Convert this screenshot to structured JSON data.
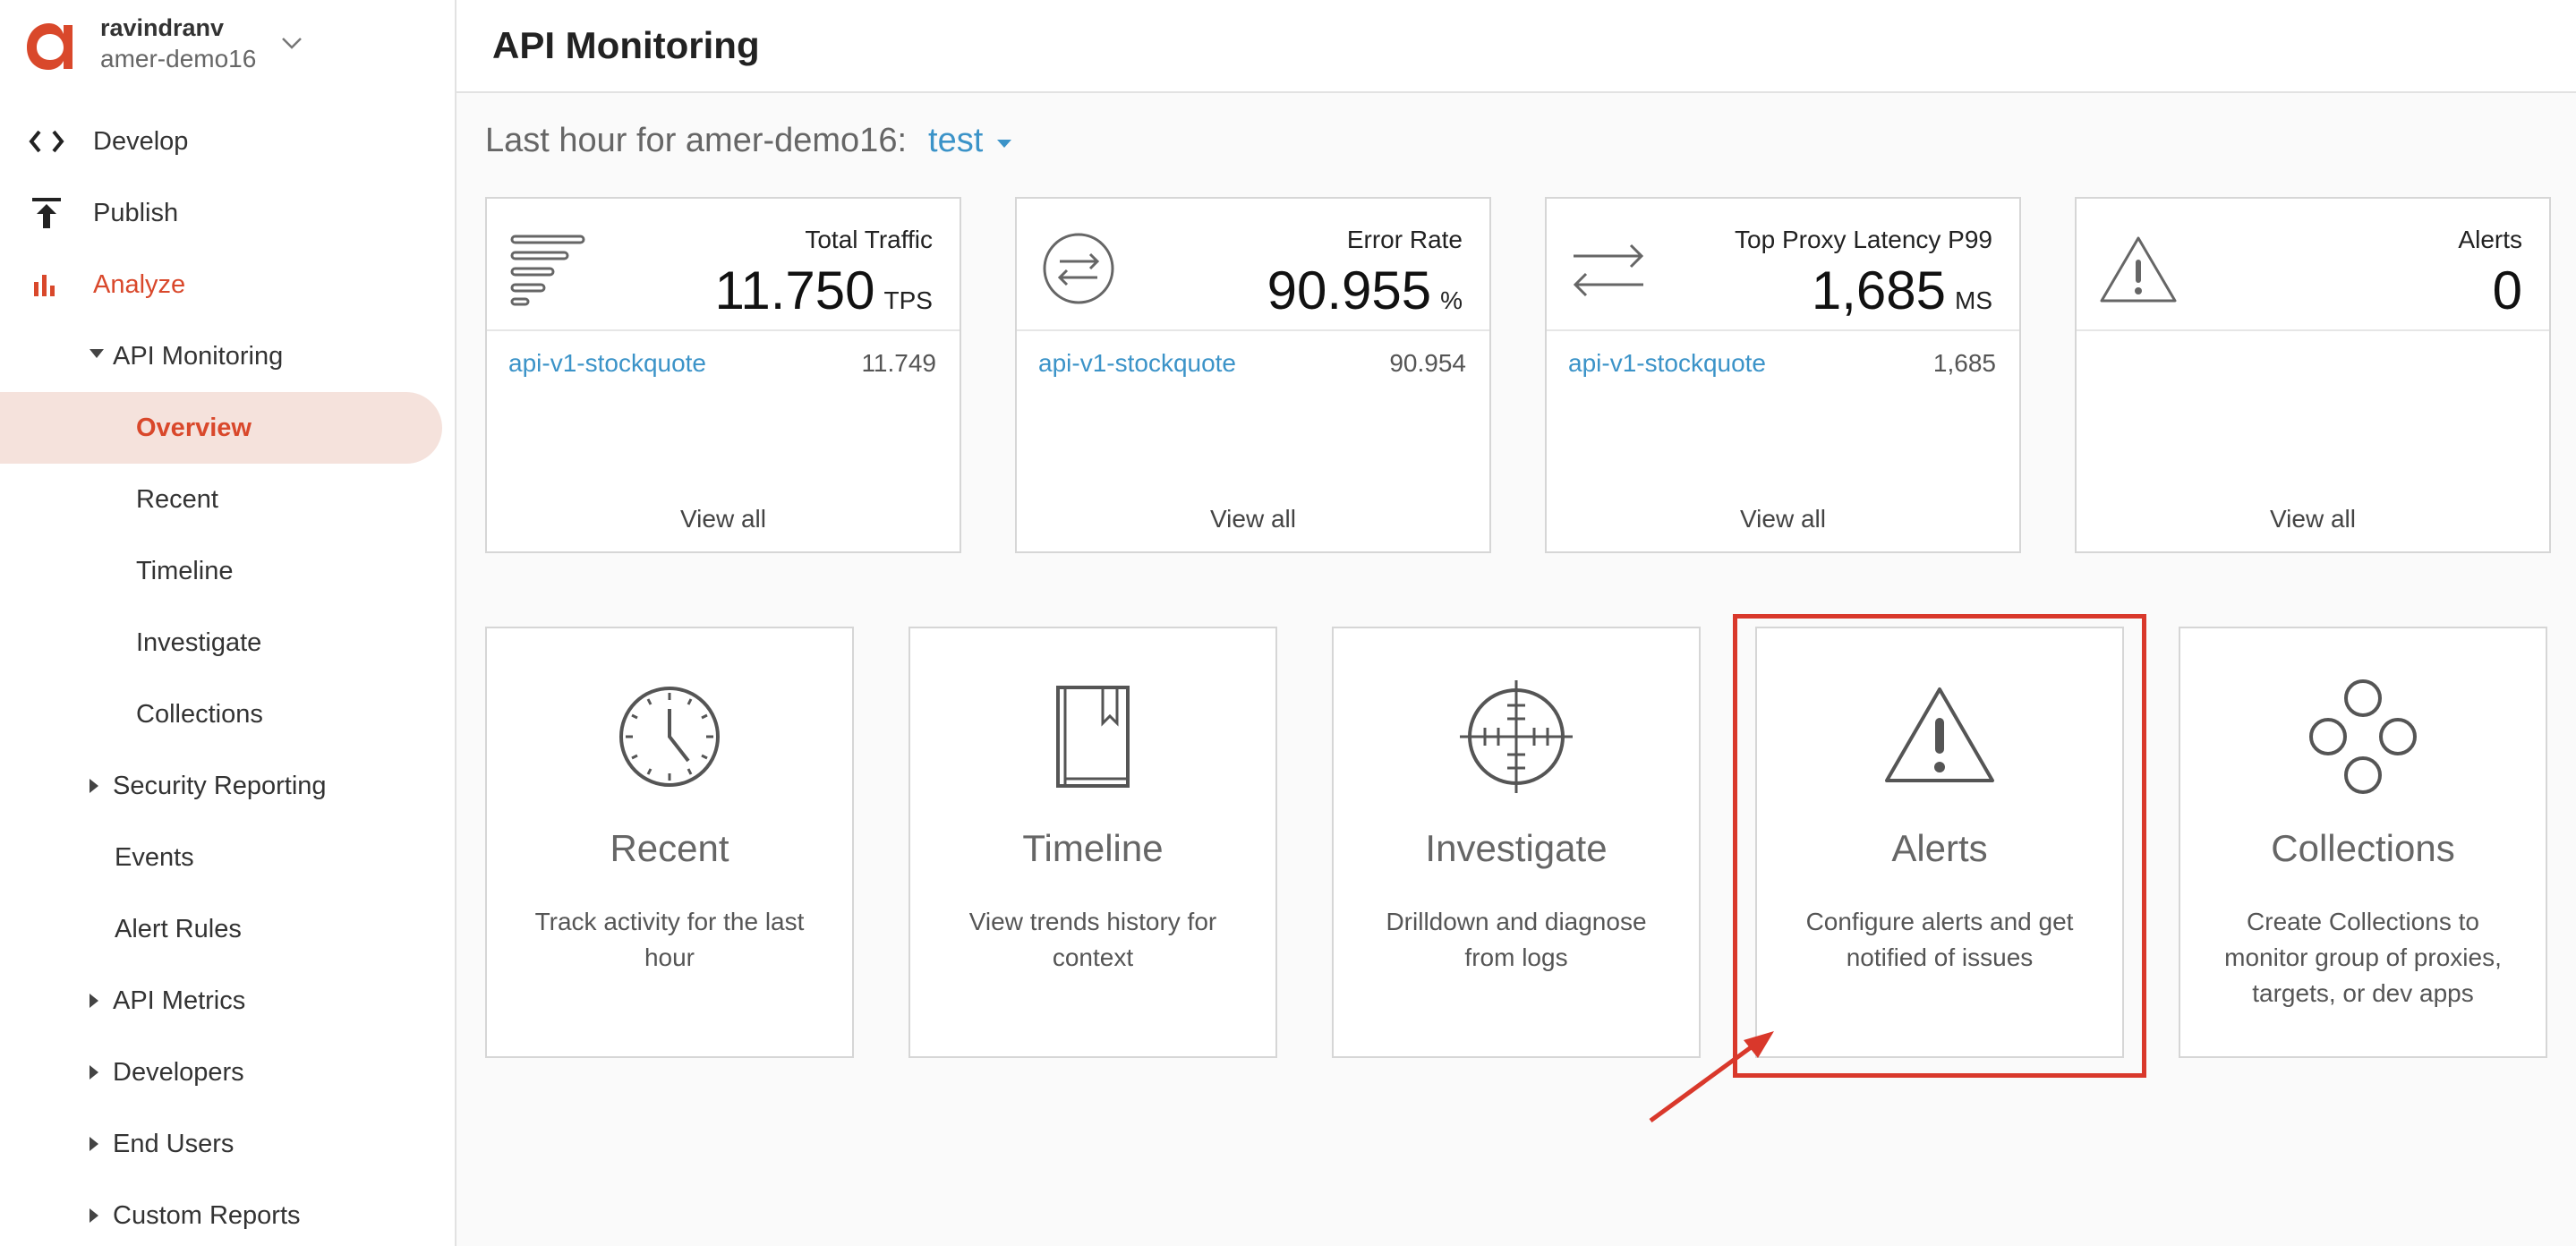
{
  "account": {
    "user": "ravindranv",
    "org": "amer-demo16"
  },
  "colors": {
    "accent": "#d9482b",
    "link": "#3b93c8",
    "selected_bg": "#f5e2dc",
    "highlight_border": "#d9382b"
  },
  "nav": {
    "develop": "Develop",
    "publish": "Publish",
    "analyze": "Analyze"
  },
  "subnav": {
    "api_monitoring": "API Monitoring",
    "overview": "Overview",
    "recent": "Recent",
    "timeline": "Timeline",
    "investigate": "Investigate",
    "collections": "Collections",
    "security_reporting": "Security Reporting",
    "events": "Events",
    "alert_rules": "Alert Rules",
    "api_metrics": "API Metrics",
    "developers": "Developers",
    "end_users": "End Users",
    "custom_reports": "Custom Reports"
  },
  "header": {
    "title": "API Monitoring"
  },
  "filter": {
    "label": "Last hour for amer-demo16:",
    "environment": "test"
  },
  "metrics": {
    "traffic": {
      "title": "Total Traffic",
      "value": "11.750",
      "unit": "TPS",
      "proxy": "api-v1-stockquote",
      "proxy_value": "11.749",
      "view_all": "View all"
    },
    "error_rate": {
      "title": "Error Rate",
      "value": "90.955",
      "unit": "%",
      "proxy": "api-v1-stockquote",
      "proxy_value": "90.954",
      "view_all": "View all"
    },
    "latency": {
      "title": "Top Proxy Latency P99",
      "value": "1,685",
      "unit": "MS",
      "proxy": "api-v1-stockquote",
      "proxy_value": "1,685",
      "view_all": "View all"
    },
    "alerts": {
      "title": "Alerts",
      "value": "0",
      "view_all": "View all"
    }
  },
  "tiles": {
    "recent": {
      "title": "Recent",
      "desc": "Track activity for the last hour",
      "icon": "clock-icon"
    },
    "timeline": {
      "title": "Timeline",
      "desc": "View trends history for context",
      "icon": "book-icon"
    },
    "investigate": {
      "title": "Investigate",
      "desc": "Drilldown and diagnose from logs",
      "icon": "crosshair-icon"
    },
    "alerts": {
      "title": "Alerts",
      "desc": "Configure alerts and get notified of issues",
      "icon": "warning-icon"
    },
    "collections": {
      "title": "Collections",
      "desc": "Create Collections to monitor group of proxies, targets, or dev apps",
      "icon": "circles-icon"
    }
  }
}
